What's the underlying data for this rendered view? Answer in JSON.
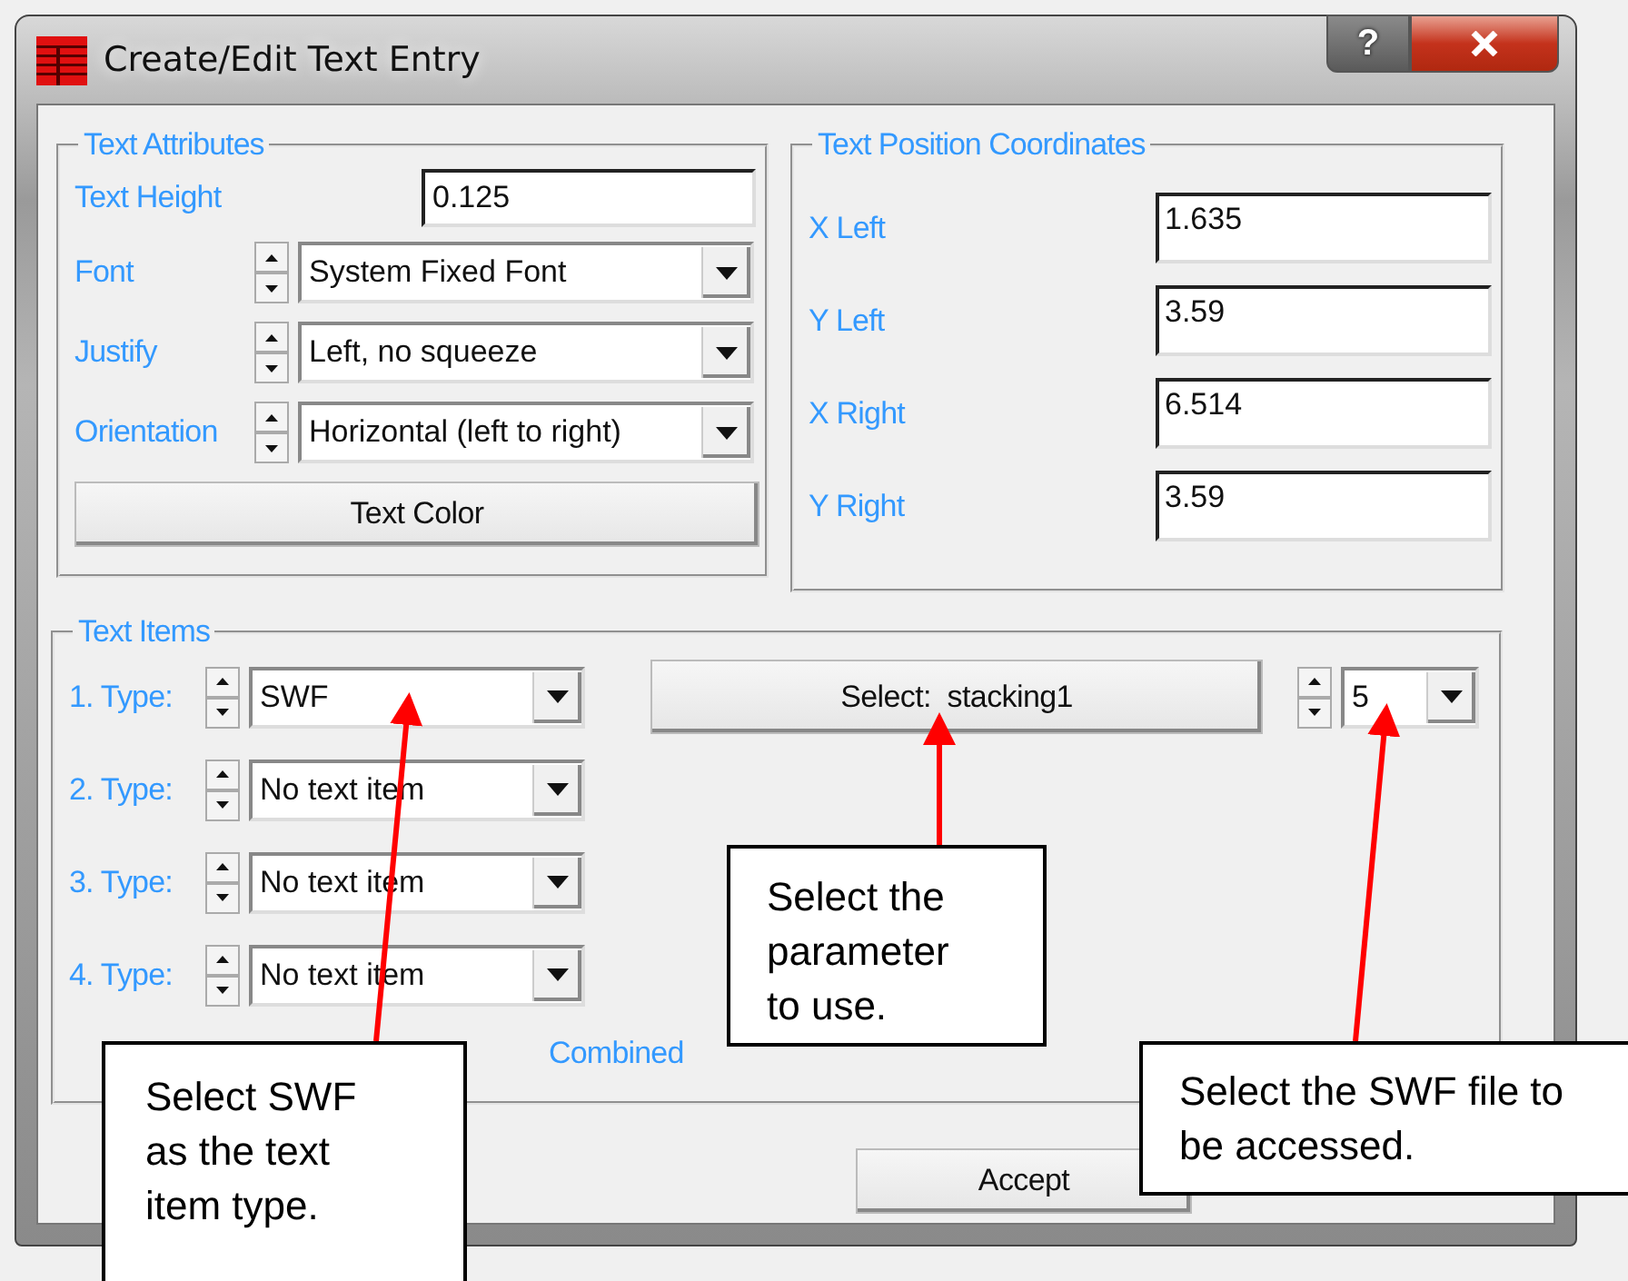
{
  "window": {
    "title": "Create/Edit Text Entry",
    "help_button": "?"
  },
  "text_attributes": {
    "title": "Text Attributes",
    "text_height": {
      "label": "Text Height",
      "value": "0.125"
    },
    "selectors": [
      {
        "label": "Font",
        "value": "System Fixed Font"
      },
      {
        "label": "Justify",
        "value": "Left, no squeeze"
      },
      {
        "label": "Orientation",
        "value": "Horizontal (left to right)"
      }
    ],
    "color_button": "Text Color"
  },
  "text_position": {
    "title": "Text Position Coordinates",
    "fields": [
      {
        "label": "X Left",
        "value": "1.635"
      },
      {
        "label": "Y Left",
        "value": "3.59"
      },
      {
        "label": "X Right",
        "value": "6.514"
      },
      {
        "label": "Y Right",
        "value": "3.59"
      }
    ]
  },
  "text_items": {
    "title": "Text Items",
    "types": [
      {
        "label": "1. Type:",
        "value": "SWF"
      },
      {
        "label": "2. Type:",
        "value": "No text item"
      },
      {
        "label": "3. Type:",
        "value": "No text item"
      },
      {
        "label": "4. Type:",
        "value": "No text item"
      }
    ],
    "select_button": "Select:  stacking1",
    "file_number": "5",
    "combined": "Combined"
  },
  "buttons": [
    "Accept"
  ],
  "callouts": [
    {
      "text": "Select SWF as the text item type."
    },
    {
      "text": "Select the parameter to use."
    },
    {
      "text": "Select the SWF file to be accessed."
    }
  ]
}
